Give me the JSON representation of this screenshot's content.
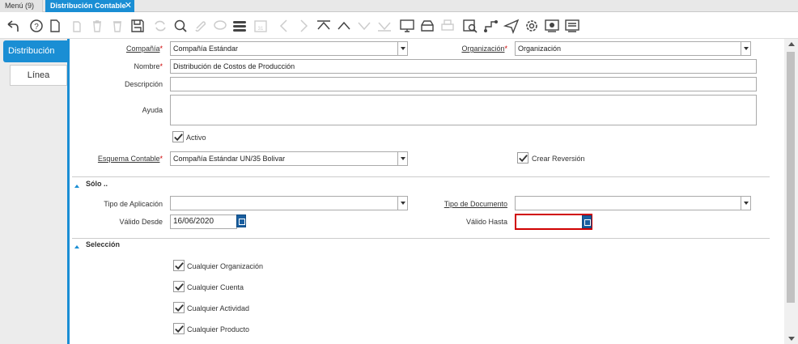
{
  "tabs": {
    "menu": "Menú (9)",
    "active": "Distribución Contable"
  },
  "toolbar": {
    "icons": [
      "undo-icon",
      "help-icon",
      "new-record-icon",
      "copy-icon",
      "delete-icon",
      "delete-selection-icon",
      "save-icon",
      "refresh-icon",
      "find-icon",
      "attachment-icon",
      "chat-icon",
      "grid-toggle-icon",
      "calendar-icon",
      "previous-icon",
      "next-icon",
      "first-record-icon",
      "parent-record-icon",
      "child-record-icon",
      "last-record-icon",
      "report-icon",
      "archive-icon",
      "print-icon",
      "zoom-across-icon",
      "workflow-icon",
      "request-icon",
      "settings-icon",
      "product-info-icon",
      "process-icon"
    ]
  },
  "left_tabs": {
    "distribucion": "Distribución",
    "linea": "Línea"
  },
  "form": {
    "compania_label": "Compañía",
    "compania_value": "Compañía Estándar",
    "organizacion_label": "Organización",
    "organizacion_value": "Organización",
    "nombre_label": "Nombre",
    "nombre_value": "Distribución de Costos de Producción",
    "descripcion_label": "Descripción",
    "descripcion_value": "",
    "ayuda_label": "Ayuda",
    "ayuda_value": "",
    "activo_label": "Activo",
    "activo_checked": true,
    "esquema_label": "Esquema Contable",
    "esquema_value": "Compañía Estándar UN/35 Bolivar",
    "crear_reversion_label": "Crear Reversión",
    "crear_reversion_checked": true,
    "required_mark": "*"
  },
  "solo": {
    "title": "Sólo ..",
    "tipo_aplicacion_label": "Tipo de Aplicación",
    "tipo_aplicacion_value": "",
    "tipo_documento_label": "Tipo de Documento",
    "tipo_documento_value": "",
    "valido_desde_label": "Válido Desde",
    "valido_desde_value": "16/06/2020",
    "valido_hasta_label": "Válido Hasta",
    "valido_hasta_value": ""
  },
  "seleccion": {
    "title": "Selección",
    "items": [
      {
        "label": "Cualquier Organización",
        "checked": true
      },
      {
        "label": "Cualquier Cuenta",
        "checked": true
      },
      {
        "label": "Cualquier Actividad",
        "checked": true
      },
      {
        "label": "Cualquier Producto",
        "checked": true
      }
    ]
  },
  "colors": {
    "accent": "#1a8ed4",
    "error_border": "#d00000"
  }
}
